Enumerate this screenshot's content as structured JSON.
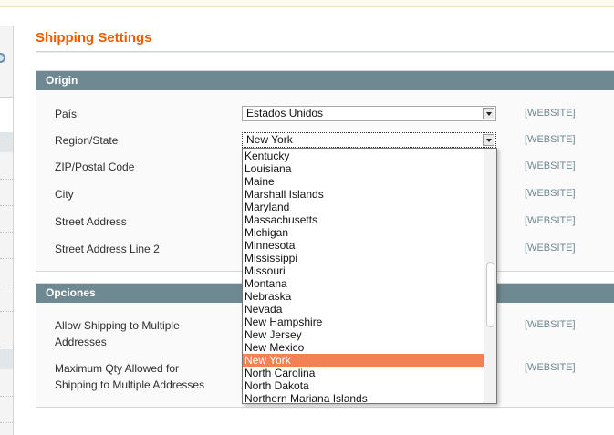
{
  "page": {
    "title": "Shipping Settings"
  },
  "origin": {
    "header": "Origin",
    "rows": [
      {
        "label": "País",
        "scope": "[WEBSITE]",
        "value": "Estados Unidos"
      },
      {
        "label": "Region/State",
        "scope": "[WEBSITE]",
        "value": "New York"
      },
      {
        "label": "ZIP/Postal Code",
        "scope": "[WEBSITE]"
      },
      {
        "label": "City",
        "scope": "[WEBSITE]"
      },
      {
        "label": "Street Address",
        "scope": "[WEBSITE]"
      },
      {
        "label": "Street Address Line 2",
        "scope": "[WEBSITE]"
      }
    ]
  },
  "opciones": {
    "header": "Opciones",
    "rows": [
      {
        "label_line1": "Allow Shipping to Multiple",
        "label_line2": "Addresses",
        "scope": "[WEBSITE]"
      },
      {
        "label_line1": "Maximum Qty Allowed for",
        "label_line2": "Shipping to Multiple Addresses",
        "scope": "[WEBSITE]"
      }
    ]
  },
  "region_dropdown": {
    "options": [
      "Kentucky",
      "Louisiana",
      "Maine",
      "Marshall Islands",
      "Maryland",
      "Massachusetts",
      "Michigan",
      "Minnesota",
      "Mississippi",
      "Missouri",
      "Montana",
      "Nebraska",
      "Nevada",
      "New Hampshire",
      "New Jersey",
      "New Mexico",
      "New York",
      "North Carolina",
      "North Dakota",
      "Northern Mariana Islands"
    ],
    "selected": "New York"
  },
  "colors": {
    "accent": "#eb5e00",
    "section_header": "#6f8992",
    "selected_option": "#f28155",
    "scope_text": "#6f8992"
  }
}
